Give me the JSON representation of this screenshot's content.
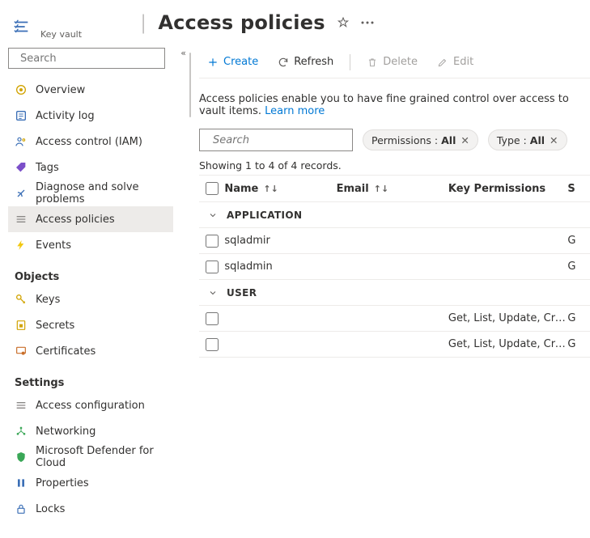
{
  "header": {
    "resource_type": "Key vault",
    "title": "Access policies"
  },
  "sidebar": {
    "search_placeholder": "Search",
    "nav": [
      {
        "icon": "overview",
        "label": "Overview"
      },
      {
        "icon": "activity",
        "label": "Activity log"
      },
      {
        "icon": "iam",
        "label": "Access control (IAM)"
      },
      {
        "icon": "tags",
        "label": "Tags"
      },
      {
        "icon": "diagnose",
        "label": "Diagnose and solve problems"
      },
      {
        "icon": "policies",
        "label": "Access policies",
        "active": true
      },
      {
        "icon": "events",
        "label": "Events"
      }
    ],
    "groups": [
      {
        "title": "Objects",
        "items": [
          {
            "icon": "keys",
            "label": "Keys"
          },
          {
            "icon": "secrets",
            "label": "Secrets"
          },
          {
            "icon": "certs",
            "label": "Certificates"
          }
        ]
      },
      {
        "title": "Settings",
        "items": [
          {
            "icon": "accesscfg",
            "label": "Access configuration"
          },
          {
            "icon": "network",
            "label": "Networking"
          },
          {
            "icon": "defender",
            "label": "Microsoft Defender for Cloud"
          },
          {
            "icon": "props",
            "label": "Properties"
          },
          {
            "icon": "locks",
            "label": "Locks"
          }
        ]
      }
    ]
  },
  "toolbar": {
    "create": "Create",
    "refresh": "Refresh",
    "delete": "Delete",
    "edit": "Edit"
  },
  "description": {
    "text": "Access policies enable you to have fine grained control over access to vault items. ",
    "link": "Learn more"
  },
  "filters": {
    "search_placeholder": "Search",
    "permissions_label": "Permissions : ",
    "permissions_value": "All",
    "type_label": "Type : ",
    "type_value": "All"
  },
  "count_text": "Showing 1 to 4 of 4 records.",
  "columns": {
    "name": "Name",
    "email": "Email",
    "key_permissions": "Key Permissions",
    "secret_permissions": "S"
  },
  "groups_data": [
    {
      "label": "APPLICATION",
      "rows": [
        {
          "name": "sqladmir",
          "email": "",
          "key_permissions": "",
          "secret_permissions": "G"
        },
        {
          "name": "sqladmin",
          "email": "",
          "key_permissions": "",
          "secret_permissions": "G"
        }
      ]
    },
    {
      "label": "USER",
      "rows": [
        {
          "name": "",
          "email": "",
          "key_permissions": "Get, List, Update, Create, ...",
          "secret_permissions": "G"
        },
        {
          "name": "",
          "email": "",
          "key_permissions": "Get, List, Update, Create, ...",
          "secret_permissions": "G"
        }
      ]
    }
  ]
}
